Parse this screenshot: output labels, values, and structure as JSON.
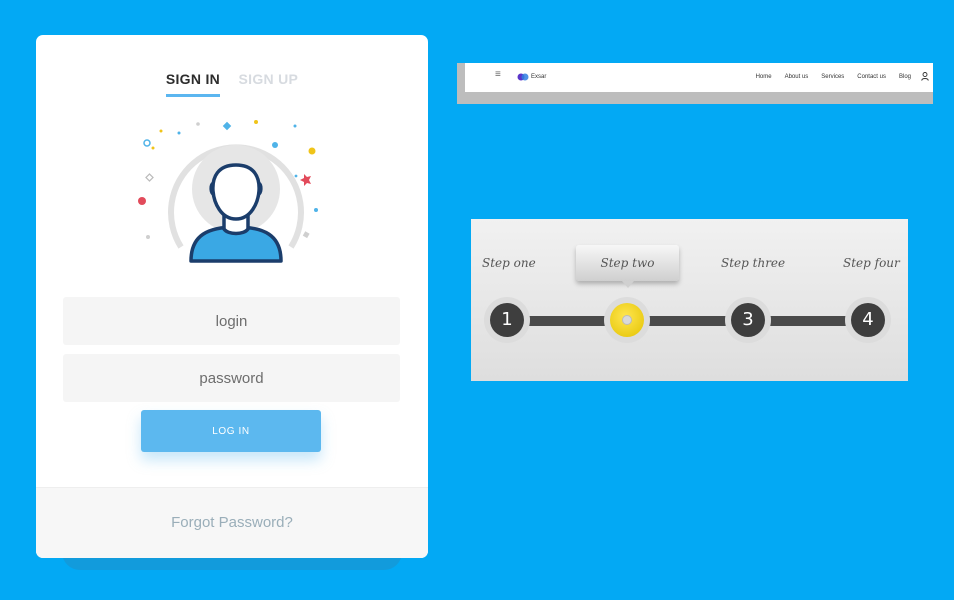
{
  "colors": {
    "background": "#03a9f4",
    "card": "#ffffff",
    "accent": "#5cb8ef",
    "step_active": "#f3d41e",
    "step_dark": "#3e3e3e"
  },
  "login_card": {
    "tabs": [
      {
        "label": "SIGN IN",
        "active": true
      },
      {
        "label": "SIGN UP",
        "active": false
      }
    ],
    "login_placeholder": "login",
    "password_placeholder": "password",
    "login_button": "LOG IN",
    "forgot_password": "Forgot Password?",
    "avatar_icon": "user-avatar-icon"
  },
  "navbar": {
    "menu_icon": "hamburger-icon",
    "brand": "Exsar",
    "links": [
      "Home",
      "About us",
      "Services",
      "Contact us",
      "Blog"
    ],
    "user_icon": "user-icon"
  },
  "stepper": {
    "steps": [
      {
        "label": "Step one",
        "number": "1"
      },
      {
        "label": "Step two",
        "number": ""
      },
      {
        "label": "Step three",
        "number": "3"
      },
      {
        "label": "Step four",
        "number": "4"
      }
    ],
    "active_step": 2
  }
}
